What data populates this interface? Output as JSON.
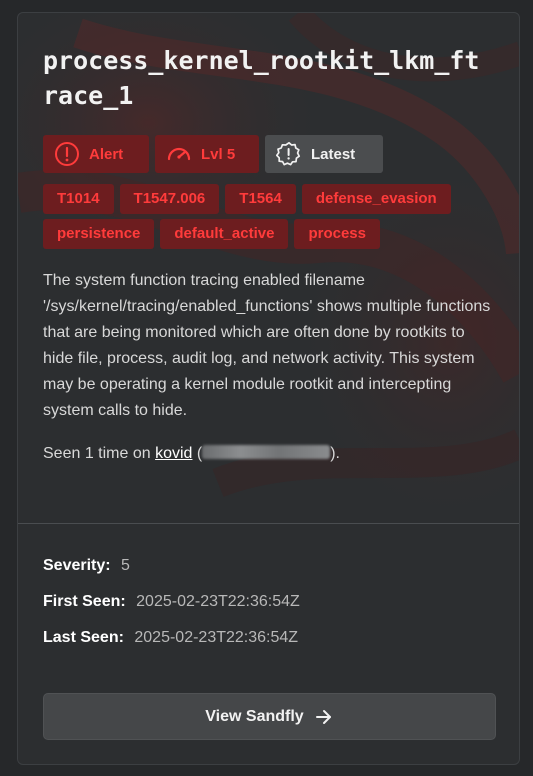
{
  "card": {
    "title": "process_kernel_rootkit_lkm_ftrace_1",
    "badges": [
      {
        "label": "Alert",
        "icon": "alert-circle-icon",
        "style": "red"
      },
      {
        "label": "Lvl 5",
        "icon": "gauge-icon",
        "style": "red"
      },
      {
        "label": "Latest",
        "icon": "badge-alert-icon",
        "style": "grey"
      }
    ],
    "tags": [
      "T1014",
      "T1547.006",
      "T1564",
      "defense_evasion",
      "persistence",
      "default_active",
      "process"
    ],
    "description": "The system function tracing enabled filename '/sys/kernel/tracing/enabled_functions' shows multiple functions that are being monitored which are often done by rootkits to hide file, process, audit log, and network activity. This system may be operating a kernel module rootkit and intercepting system calls to hide.",
    "seen": {
      "prefix": "Seen 1 time on ",
      "host": "kovid",
      "open_paren": " (",
      "close_paren": ")."
    }
  },
  "details": {
    "severity_label": "Severity:",
    "severity_value": "5",
    "first_seen_label": "First Seen:",
    "first_seen_value": "2025-02-23T22:36:54Z",
    "last_seen_label": "Last Seen:",
    "last_seen_value": "2025-02-23T22:36:54Z"
  },
  "actions": {
    "view_label": "View Sandfly",
    "view_icon": "arrow-right-icon"
  },
  "colors": {
    "alert_red": "#ff3b3b",
    "alert_bg": "#6d1d1f",
    "card_bg": "#2c2e30"
  }
}
